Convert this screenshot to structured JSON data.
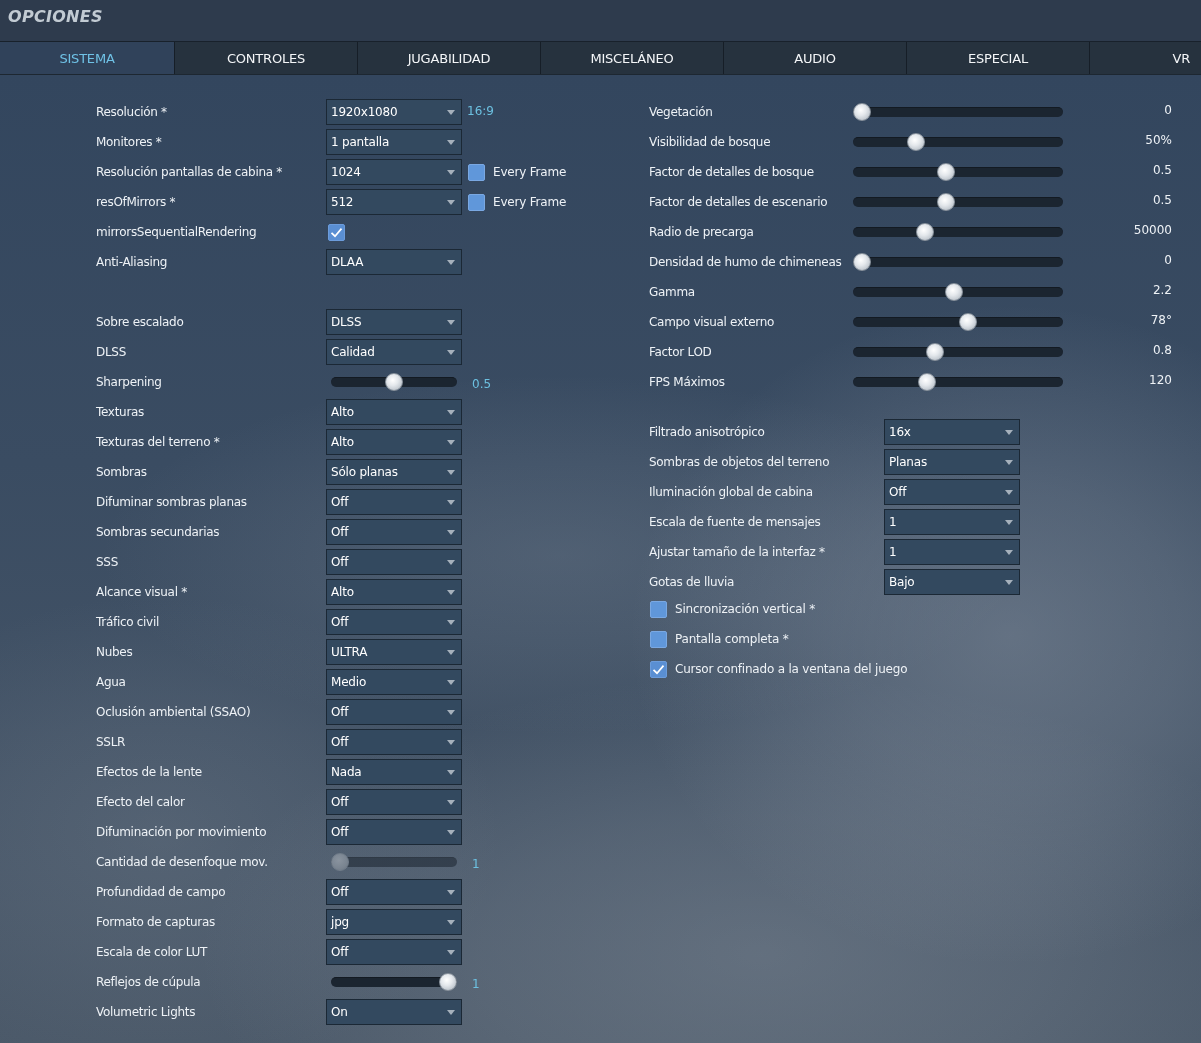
{
  "window": {
    "title": "OPCIONES"
  },
  "tabs": [
    {
      "label": "SISTEMA",
      "selected": true
    },
    {
      "label": "CONTROLES",
      "selected": false
    },
    {
      "label": "JUGABILIDAD",
      "selected": false
    },
    {
      "label": "MISCELÁNEO",
      "selected": false
    },
    {
      "label": "AUDIO",
      "selected": false
    },
    {
      "label": "ESPECIAL",
      "selected": false
    },
    {
      "label": "VR",
      "selected": false
    }
  ],
  "left_column": {
    "sections": [
      {
        "rows": [
          {
            "kind": "dropdown",
            "label": "Resolución *",
            "value": "1920x1080",
            "note": "16:9"
          },
          {
            "kind": "dropdown",
            "label": "Monitores *",
            "value": "1 pantalla"
          },
          {
            "kind": "dropdown",
            "label": "Resolución pantallas de cabina *",
            "value": "1024",
            "extra": {
              "label": "Every Frame",
              "checked": false
            }
          },
          {
            "kind": "dropdown",
            "label": "resOfMirrors *",
            "value": "512",
            "extra": {
              "label": "Every Frame",
              "checked": false
            }
          },
          {
            "kind": "checkbox",
            "label": "mirrorsSequentialRendering",
            "checked": true
          },
          {
            "kind": "dropdown",
            "label": "Anti-Aliasing",
            "value": "DLAA"
          }
        ]
      },
      {
        "rows": [
          {
            "kind": "dropdown",
            "label": "Sobre escalado",
            "value": "DLSS"
          },
          {
            "kind": "dropdown",
            "label": "DLSS",
            "value": "Calidad"
          },
          {
            "kind": "slider",
            "label": "Sharpening",
            "level": 0.5,
            "reading": "0.5",
            "disabled": false
          },
          {
            "kind": "dropdown",
            "label": "Texturas",
            "value": "Alto"
          },
          {
            "kind": "dropdown",
            "label": "Texturas del terreno *",
            "value": "Alto"
          },
          {
            "kind": "dropdown",
            "label": "Sombras",
            "value": "Sólo planas"
          },
          {
            "kind": "dropdown",
            "label": "Difuminar sombras planas",
            "value": "Off"
          },
          {
            "kind": "dropdown",
            "label": "Sombras secundarias",
            "value": "Off"
          },
          {
            "kind": "dropdown",
            "label": "SSS",
            "value": "Off"
          },
          {
            "kind": "dropdown",
            "label": "Alcance visual *",
            "value": "Alto"
          },
          {
            "kind": "dropdown",
            "label": "Tráfico civil",
            "value": "Off"
          },
          {
            "kind": "dropdown",
            "label": "Nubes",
            "value": "ULTRA"
          },
          {
            "kind": "dropdown",
            "label": "Agua",
            "value": "Medio"
          },
          {
            "kind": "dropdown",
            "label": "Oclusión ambiental (SSAO)",
            "value": "Off"
          },
          {
            "kind": "dropdown",
            "label": "SSLR",
            "value": "Off"
          },
          {
            "kind": "dropdown",
            "label": "Efectos de la lente",
            "value": "Nada"
          },
          {
            "kind": "dropdown",
            "label": "Efecto del calor",
            "value": "Off"
          },
          {
            "kind": "dropdown",
            "label": "Difuminación por movimiento",
            "value": "Off"
          },
          {
            "kind": "slider",
            "label": "Cantidad de desenfoque mov.",
            "level": 0,
            "reading": "1",
            "disabled": true
          },
          {
            "kind": "dropdown",
            "label": "Profundidad de campo",
            "value": "Off"
          },
          {
            "kind": "dropdown",
            "label": "Formato de capturas",
            "value": "jpg"
          },
          {
            "kind": "dropdown",
            "label": "Escala de color LUT",
            "value": "Off"
          },
          {
            "kind": "slider",
            "label": "Reflejos de cúpula",
            "level": 1,
            "reading": "1",
            "disabled": false
          },
          {
            "kind": "dropdown",
            "label": "Volumetric Lights",
            "value": "On"
          }
        ]
      }
    ]
  },
  "right_column": {
    "sliders": [
      {
        "label": "Vegetación",
        "level": 0,
        "reading": "0"
      },
      {
        "label": "Visibilidad de bosque",
        "level": 0.28,
        "reading": "50%"
      },
      {
        "label": "Factor de detalles de bosque",
        "level": 0.44,
        "reading": "0.5"
      },
      {
        "label": "Factor de detalles de escenario",
        "level": 0.44,
        "reading": "0.5"
      },
      {
        "label": "Radio de precarga",
        "level": 0.33,
        "reading": "50000"
      },
      {
        "label": "Densidad de humo de chimeneas",
        "level": 0,
        "reading": "0"
      },
      {
        "label": "Gamma",
        "level": 0.48,
        "reading": "2.2"
      },
      {
        "label": "Campo visual externo",
        "level": 0.55,
        "reading": "78°"
      },
      {
        "label": "Factor LOD",
        "level": 0.38,
        "reading": "0.8"
      },
      {
        "label": "FPS Máximos",
        "level": 0.34,
        "reading": "120"
      }
    ],
    "dropdowns": [
      {
        "label": "Filtrado anisotrópico",
        "value": "16x"
      },
      {
        "label": "Sombras de objetos del terreno",
        "value": "Planas"
      },
      {
        "label": "Iluminación global de cabina",
        "value": "Off"
      },
      {
        "label": "Escala de fuente de mensajes",
        "value": "1"
      },
      {
        "label": "Ajustar tamaño de la interfaz *",
        "value": "1"
      },
      {
        "label": "Gotas de lluvia",
        "value": "Bajo"
      }
    ],
    "checkboxes": [
      {
        "label": "Sincronización vertical *",
        "checked": false
      },
      {
        "label": "Pantalla completa *",
        "checked": false
      },
      {
        "label": "Cursor confinado a la ventana del juego",
        "checked": true
      }
    ]
  }
}
